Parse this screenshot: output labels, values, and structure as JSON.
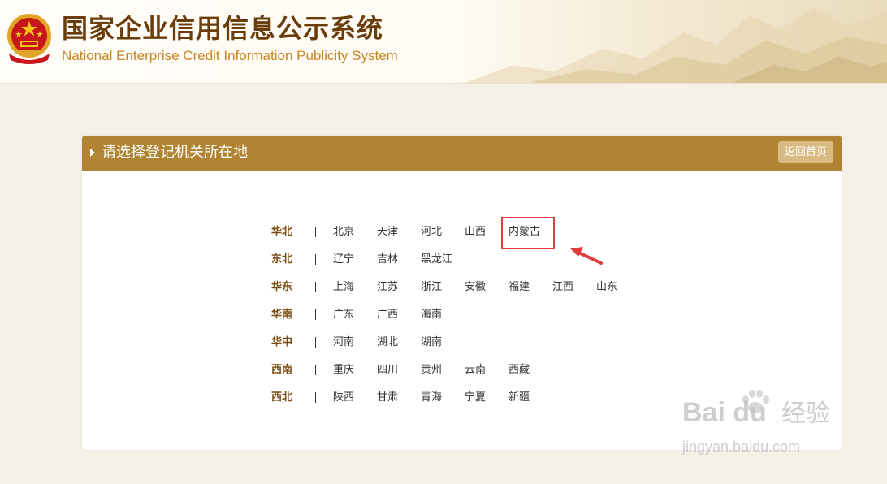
{
  "header": {
    "title_cn": "国家企业信用信息公示系统",
    "title_en": "National Enterprise Credit Information Publicity System"
  },
  "panel": {
    "title": "请选择登记机关所在地",
    "back_label": "返回首页"
  },
  "regions": [
    {
      "name": "华北",
      "provinces": [
        "北京",
        "天津",
        "河北",
        "山西",
        "内蒙古"
      ]
    },
    {
      "name": "东北",
      "provinces": [
        "辽宁",
        "吉林",
        "黑龙江"
      ]
    },
    {
      "name": "华东",
      "provinces": [
        "上海",
        "江苏",
        "浙江",
        "安徽",
        "福建",
        "江西",
        "山东"
      ]
    },
    {
      "name": "华南",
      "provinces": [
        "广东",
        "广西",
        "海南"
      ]
    },
    {
      "name": "华中",
      "provinces": [
        "河南",
        "湖北",
        "湖南"
      ]
    },
    {
      "name": "西南",
      "provinces": [
        "重庆",
        "四川",
        "贵州",
        "云南",
        "西藏"
      ]
    },
    {
      "name": "西北",
      "provinces": [
        "陕西",
        "甘肃",
        "青海",
        "宁夏",
        "新疆"
      ]
    }
  ],
  "annotation": {
    "highlighted": "内蒙古",
    "highlight_color": "#e23b3b"
  },
  "watermark": {
    "brand": "Bai du",
    "cn": "经验",
    "url": "jingyan.baidu.com"
  },
  "colors": {
    "panel_header": "#b08432",
    "region_label": "#7a4d12",
    "title_cn": "#6b3d0b",
    "title_en": "#c9841f"
  },
  "icons": [
    "national-emblem-icon",
    "caret-right-icon",
    "red-arrow-icon",
    "paw-icon"
  ]
}
